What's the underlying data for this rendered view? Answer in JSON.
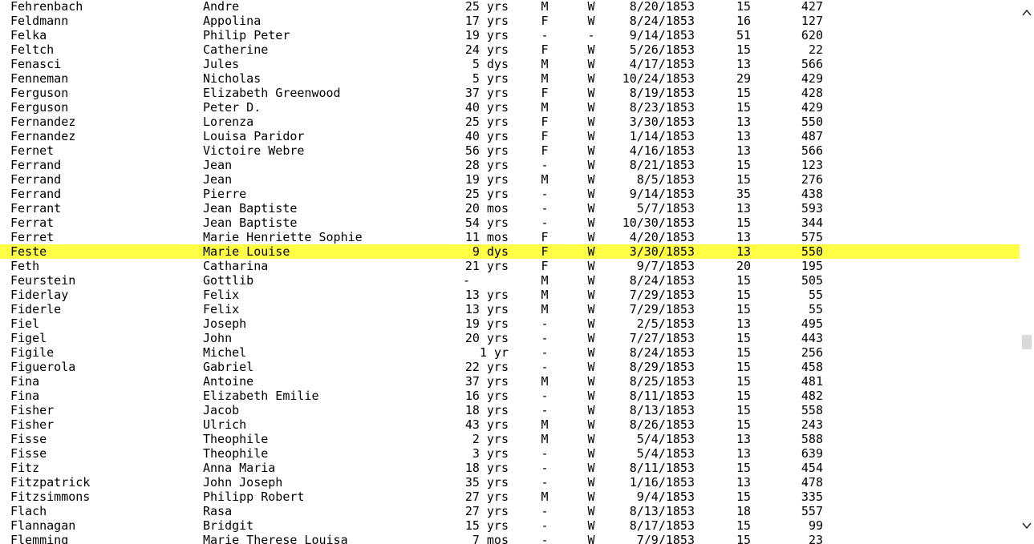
{
  "table": {
    "rows": [
      {
        "last": "Fehrenbach",
        "first": "Andre",
        "age": "25 yrs",
        "sex": "M",
        "race": "W",
        "date": "8/20/1853",
        "col8": "15",
        "col9": "427"
      },
      {
        "last": "Feldmann",
        "first": "Appolina",
        "age": "17 yrs",
        "sex": "F",
        "race": "W",
        "date": "8/24/1853",
        "col8": "16",
        "col9": "127"
      },
      {
        "last": "Felka",
        "first": "Philip Peter",
        "age": "19 yrs",
        "sex": "-",
        "race": "-",
        "date": "9/14/1853",
        "col8": "51",
        "col9": "620"
      },
      {
        "last": "Feltch",
        "first": "Catherine",
        "age": "24 yrs",
        "sex": "F",
        "race": "W",
        "date": "5/26/1853",
        "col8": "15",
        "col9": "22"
      },
      {
        "last": "Fenasci",
        "first": "Jules",
        "age": "5 dys",
        "sex": "M",
        "race": "W",
        "date": "4/17/1853",
        "col8": "13",
        "col9": "566"
      },
      {
        "last": "Fenneman",
        "first": "Nicholas",
        "age": "5 yrs",
        "sex": "M",
        "race": "W",
        "date": "10/24/1853",
        "col8": "29",
        "col9": "429"
      },
      {
        "last": "Ferguson",
        "first": "Elizabeth Greenwood",
        "age": "37 yrs",
        "sex": "F",
        "race": "W",
        "date": "8/19/1853",
        "col8": "15",
        "col9": "428"
      },
      {
        "last": "Ferguson",
        "first": "Peter D.",
        "age": "40 yrs",
        "sex": "M",
        "race": "W",
        "date": "8/23/1853",
        "col8": "15",
        "col9": "429"
      },
      {
        "last": "Fernandez",
        "first": "Lorenza",
        "age": "25 yrs",
        "sex": "F",
        "race": "W",
        "date": "3/30/1853",
        "col8": "13",
        "col9": "550"
      },
      {
        "last": "Fernandez",
        "first": "Louisa Paridor",
        "age": "40 yrs",
        "sex": "F",
        "race": "W",
        "date": "1/14/1853",
        "col8": "13",
        "col9": "487"
      },
      {
        "last": "Fernet",
        "first": "Victoire Webre",
        "age": "56 yrs",
        "sex": "F",
        "race": "W",
        "date": "4/16/1853",
        "col8": "13",
        "col9": "566"
      },
      {
        "last": "Ferrand",
        "first": "Jean",
        "age": "28 yrs",
        "sex": "-",
        "race": "W",
        "date": "8/21/1853",
        "col8": "15",
        "col9": "123"
      },
      {
        "last": "Ferrand",
        "first": "Jean",
        "age": "19 yrs",
        "sex": "M",
        "race": "W",
        "date": "8/5/1853",
        "col8": "15",
        "col9": "276"
      },
      {
        "last": "Ferrand",
        "first": "Pierre",
        "age": "25 yrs",
        "sex": "-",
        "race": "W",
        "date": "9/14/1853",
        "col8": "35",
        "col9": "438"
      },
      {
        "last": "Ferrant",
        "first": "Jean Baptiste",
        "age": "20 mos",
        "sex": "-",
        "race": "W",
        "date": "5/7/1853",
        "col8": "13",
        "col9": "593"
      },
      {
        "last": "Ferrat",
        "first": "Jean Baptiste",
        "age": "54 yrs",
        "sex": "-",
        "race": "W",
        "date": "10/30/1853",
        "col8": "15",
        "col9": "344"
      },
      {
        "last": "Ferret",
        "first": "Marie Henriette Sophie",
        "age": "11 mos",
        "sex": "F",
        "race": "W",
        "date": "4/20/1853",
        "col8": "13",
        "col9": "575"
      },
      {
        "last": "Feste",
        "first": "Marie Louise",
        "age": "9 dys",
        "sex": "F",
        "race": "W",
        "date": "3/30/1853",
        "col8": "13",
        "col9": "550",
        "highlight": true
      },
      {
        "last": "Feth",
        "first": "Catharina",
        "age": "21 yrs",
        "sex": "F",
        "race": "W",
        "date": "9/7/1853",
        "col8": "20",
        "col9": "195"
      },
      {
        "last": "Feurstein",
        "first": "Gottlib",
        "age": "-",
        "sex": "M",
        "race": "W",
        "date": "8/24/1853",
        "col8": "15",
        "col9": "505",
        "age_dash": true
      },
      {
        "last": "Fiderlay",
        "first": "Felix",
        "age": "13 yrs",
        "sex": "M",
        "race": "W",
        "date": "7/29/1853",
        "col8": "15",
        "col9": "55"
      },
      {
        "last": "Fiderle",
        "first": "Felix",
        "age": "13 yrs",
        "sex": "M",
        "race": "W",
        "date": "7/29/1853",
        "col8": "15",
        "col9": "55"
      },
      {
        "last": "Fiel",
        "first": "Joseph",
        "age": "19 yrs",
        "sex": "-",
        "race": "W",
        "date": "2/5/1853",
        "col8": "13",
        "col9": "495"
      },
      {
        "last": "Figel",
        "first": "John",
        "age": "20 yrs",
        "sex": "-",
        "race": "W",
        "date": "7/27/1853",
        "col8": "15",
        "col9": "443"
      },
      {
        "last": "Figile",
        "first": "Michel",
        "age": "1 yr",
        "sex": "-",
        "race": "W",
        "date": "8/24/1853",
        "col8": "15",
        "col9": "256"
      },
      {
        "last": "Figuerola",
        "first": "Gabriel",
        "age": "22 yrs",
        "sex": "-",
        "race": "W",
        "date": "8/29/1853",
        "col8": "15",
        "col9": "458"
      },
      {
        "last": "Fina",
        "first": "Antoine",
        "age": "37 yrs",
        "sex": "M",
        "race": "W",
        "date": "8/25/1853",
        "col8": "15",
        "col9": "481"
      },
      {
        "last": "Fina",
        "first": "Elizabeth Emilie",
        "age": "16 yrs",
        "sex": "-",
        "race": "W",
        "date": "8/11/1853",
        "col8": "15",
        "col9": "482"
      },
      {
        "last": "Fisher",
        "first": "Jacob",
        "age": "18 yrs",
        "sex": "-",
        "race": "W",
        "date": "8/13/1853",
        "col8": "15",
        "col9": "558"
      },
      {
        "last": "Fisher",
        "first": "Ulrich",
        "age": "43 yrs",
        "sex": "M",
        "race": "W",
        "date": "8/26/1853",
        "col8": "15",
        "col9": "243"
      },
      {
        "last": "Fisse",
        "first": "Theophile",
        "age": "2 yrs",
        "sex": "M",
        "race": "W",
        "date": "5/4/1853",
        "col8": "13",
        "col9": "588"
      },
      {
        "last": "Fisse",
        "first": "Theophile",
        "age": "3 yrs",
        "sex": "-",
        "race": "W",
        "date": "5/4/1853",
        "col8": "13",
        "col9": "639"
      },
      {
        "last": "Fitz",
        "first": "Anna Maria",
        "age": "18 yrs",
        "sex": "-",
        "race": "W",
        "date": "8/11/1853",
        "col8": "15",
        "col9": "454"
      },
      {
        "last": "Fitzpatrick",
        "first": "John Joseph",
        "age": "35 yrs",
        "sex": "-",
        "race": "W",
        "date": "1/16/1853",
        "col8": "13",
        "col9": "478"
      },
      {
        "last": "Fitzsimmons",
        "first": "Philipp Robert",
        "age": "27 yrs",
        "sex": "M",
        "race": "W",
        "date": "9/4/1853",
        "col8": "15",
        "col9": "335"
      },
      {
        "last": "Flach",
        "first": "Rasa",
        "age": "27 yrs",
        "sex": "-",
        "race": "W",
        "date": "8/13/1853",
        "col8": "18",
        "col9": "557"
      },
      {
        "last": "Flannagan",
        "first": "Bridgit",
        "age": "15 yrs",
        "sex": "-",
        "race": "W",
        "date": "8/17/1853",
        "col8": "15",
        "col9": "99"
      },
      {
        "last": "Flemming",
        "first": "Marie Therese Louisa",
        "age": "7 mos",
        "sex": "-",
        "race": "W",
        "date": "7/9/1853",
        "col8": "15",
        "col9": "23"
      }
    ]
  },
  "colors": {
    "highlight": "#ffff44",
    "text": "#000000",
    "scroll_thumb": "#dadada"
  },
  "scrollbar": {
    "up_icon": "chevron-up-icon",
    "down_icon": "chevron-down-icon",
    "position": 0.62
  }
}
